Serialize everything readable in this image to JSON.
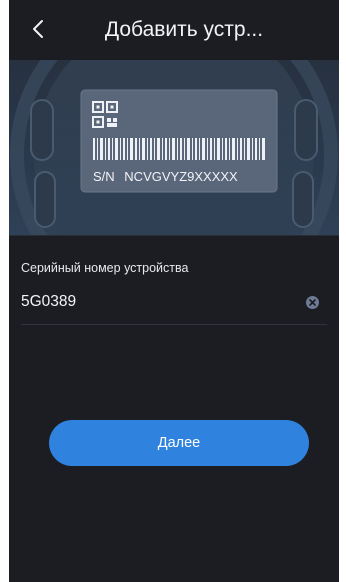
{
  "header": {
    "title": "Добавить устр...",
    "back_icon": "chevron-left-icon"
  },
  "device_image": {
    "serial_label": "S/N",
    "serial_value": "NCVGVYZ9XXXXX"
  },
  "serial_field": {
    "label": "Серийный номер устройства",
    "value": "5G0389",
    "clear_icon": "clear-icon"
  },
  "actions": {
    "next_label": "Далее"
  },
  "colors": {
    "background": "#1b1d22",
    "accent": "#2f82dd",
    "hero": "#2a3a4e"
  }
}
